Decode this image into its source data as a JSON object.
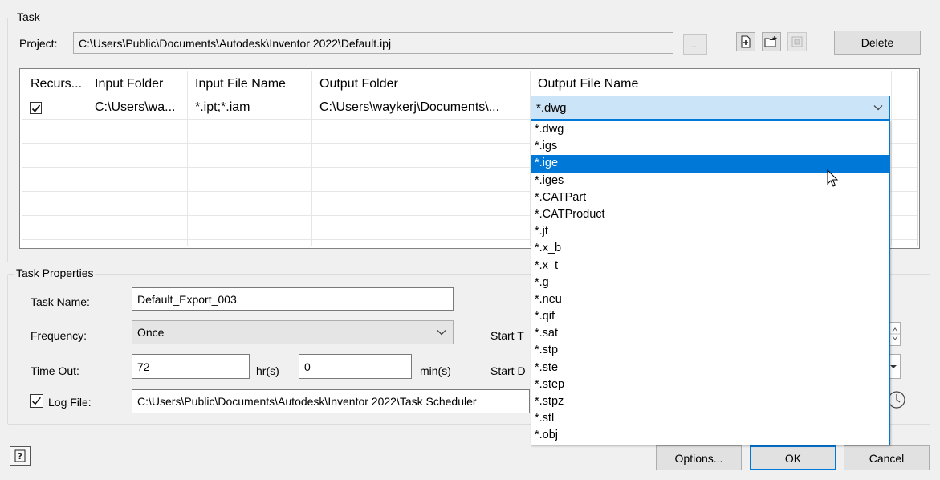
{
  "task_group": {
    "title": "Task",
    "project_label": "Project:",
    "project_path": "C:\\Users\\Public\\Documents\\Autodesk\\Inventor 2022\\Default.ipj",
    "browse_label": "...",
    "delete_label": "Delete"
  },
  "grid": {
    "columns": [
      "Recurs...",
      "Input Folder",
      "Input File Name",
      "Output Folder",
      "Output File Name"
    ],
    "rows": [
      {
        "recursive_checked": true,
        "input_folder": "C:\\Users\\wa...",
        "input_file_name": "*.ipt;*.iam",
        "output_folder": "C:\\Users\\waykerj\\Documents\\...",
        "output_file_name": "*.dwg"
      }
    ]
  },
  "output_dropdown": {
    "selected": "*.ige",
    "options": [
      "*.dwg",
      "*.igs",
      "*.ige",
      "*.iges",
      "*.CATPart",
      "*.CATProduct",
      "*.jt",
      "*.x_b",
      "*.x_t",
      "*.g",
      "*.neu",
      "*.qif",
      "*.sat",
      "*.stp",
      "*.ste",
      "*.step",
      "*.stpz",
      "*.stl",
      "*.obj"
    ]
  },
  "task_properties": {
    "title": "Task Properties",
    "task_name_label": "Task Name:",
    "task_name_value": "Default_Export_003",
    "frequency_label": "Frequency:",
    "frequency_value": "Once",
    "time_out_label": "Time Out:",
    "time_out_hours": "72",
    "hours_unit": "hr(s)",
    "time_out_minutes": "0",
    "minutes_unit": "min(s)",
    "log_file_label": "Log File:",
    "log_file_checked": true,
    "log_file_path": "C:\\Users\\Public\\Documents\\Autodesk\\Inventor 2022\\Task Scheduler",
    "start_time_label_partial": "Start T",
    "start_date_label_partial": "Start D"
  },
  "footer": {
    "options_label": "Options...",
    "ok_label": "OK",
    "cancel_label": "Cancel"
  },
  "colors": {
    "accent": "#0078d7",
    "selection_bg": "#cce4f7",
    "window_bg": "#f0f0f0"
  }
}
